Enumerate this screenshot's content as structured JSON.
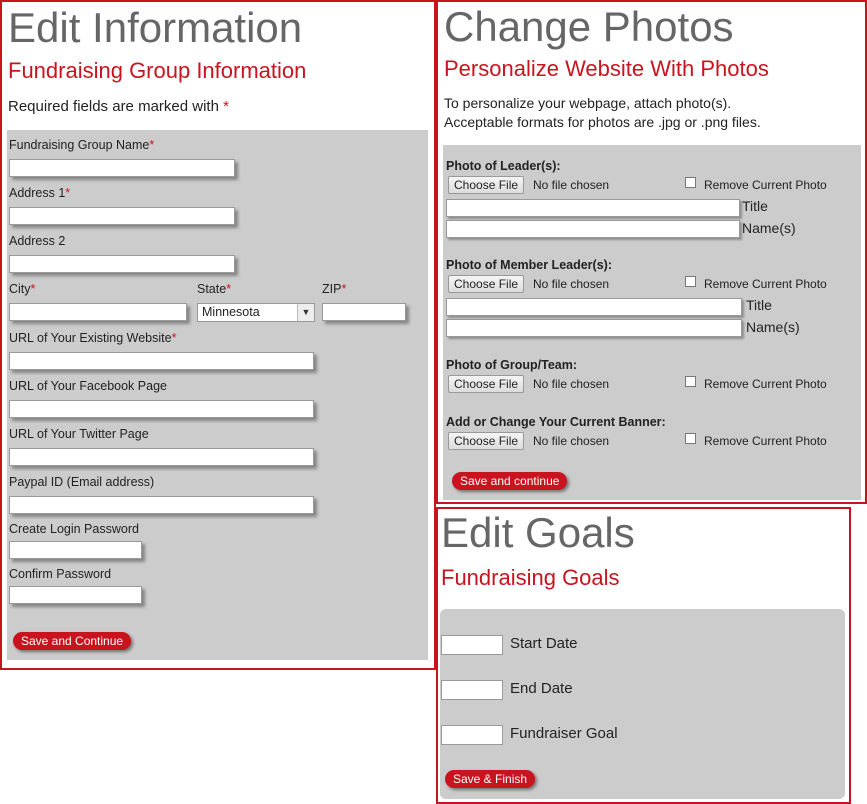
{
  "edit_info": {
    "title": "Edit Information",
    "subtitle": "Fundraising Group Information",
    "required_note": "Required fields are marked with",
    "required_star": "*",
    "fields": {
      "group_name": "Fundraising Group Name",
      "address1": "Address 1",
      "address2": "Address 2",
      "city": "City",
      "state": "State",
      "zip": "ZIP",
      "website": "URL of Your Existing Website",
      "facebook": "URL of Your Facebook Page",
      "twitter": "URL of Your Twitter Page",
      "paypal": "Paypal ID (Email address)",
      "password": "Create Login Password",
      "confirm": "Confirm Password"
    },
    "state_value": "Minnesota",
    "save_label": "Save and Continue"
  },
  "photos": {
    "title": "Change Photos",
    "subtitle": "Personalize Website With Photos",
    "intro_line1": "To personalize your webpage, attach photo(s).",
    "intro_line2": "Acceptable formats for photos are .jpg or .png files.",
    "choose_label": "Choose File",
    "no_file": "No file chosen",
    "remove_label": "Remove Current Photo",
    "title_label": "Title",
    "names_label": "Name(s)",
    "sections": {
      "leader": "Photo of Leader(s):",
      "member_leader": "Photo of Member Leader(s):",
      "group": "Photo of Group/Team:",
      "banner": "Add or Change Your Current Banner:"
    },
    "save_label": "Save and continue"
  },
  "goals": {
    "title": "Edit Goals",
    "subtitle": "Fundraising Goals",
    "start_date": "Start Date",
    "end_date": "End Date",
    "goal": "Fundraiser Goal",
    "save_label": "Save & Finish"
  },
  "colors": {
    "accent": "#c8141e",
    "panel_grey": "#cccccc",
    "heading_grey": "#666666"
  }
}
